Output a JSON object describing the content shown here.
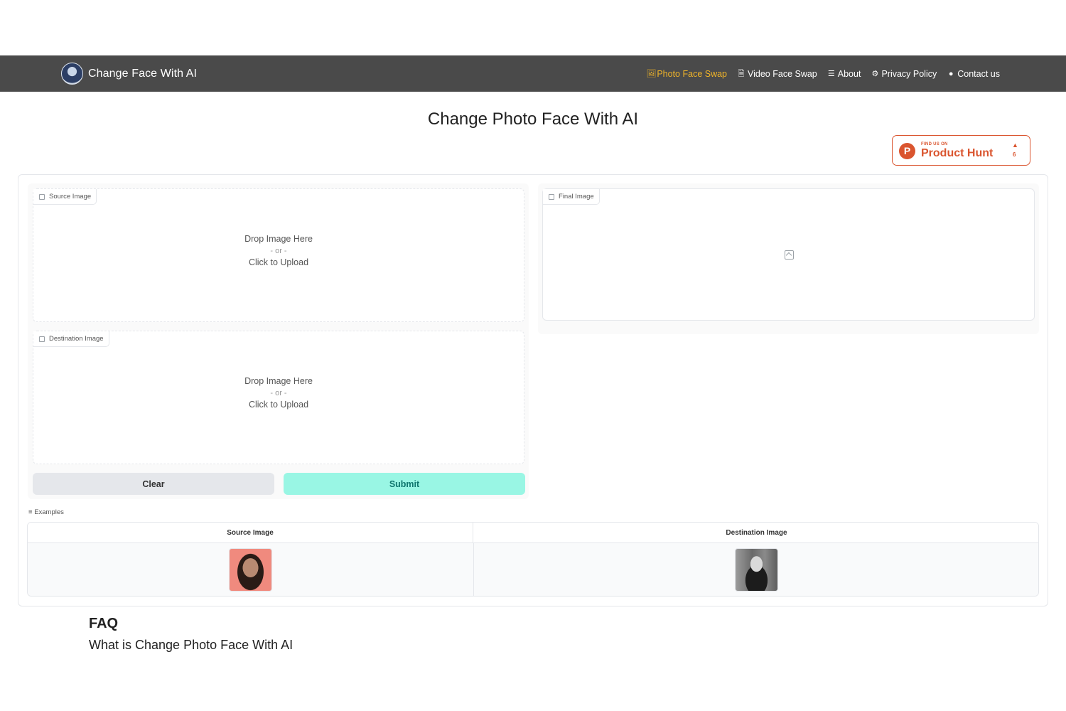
{
  "brand": {
    "title": "Change Face With AI",
    "icon": "avatar-logo"
  },
  "nav": {
    "items": [
      {
        "label": "Photo Face Swap",
        "icon": "image-file-icon",
        "active": true
      },
      {
        "label": "Video Face Swap",
        "icon": "video-file-icon",
        "active": false
      },
      {
        "label": "About",
        "icon": "list-icon",
        "active": false
      },
      {
        "label": "Privacy Policy",
        "icon": "lock-icon",
        "active": false
      },
      {
        "label": "Contact us",
        "icon": "chat-icon",
        "active": false
      }
    ],
    "active_color": "#f0b429"
  },
  "page": {
    "title": "Change Photo Face With AI"
  },
  "product_hunt": {
    "small_text": "FIND US ON",
    "name": "Product Hunt",
    "count": "6",
    "color": "#da552f"
  },
  "source": {
    "label": "Source Image",
    "drop": "Drop Image Here",
    "or": "- or -",
    "click": "Click to Upload"
  },
  "destination": {
    "label": "Destination Image",
    "drop": "Drop Image Here",
    "or": "- or -",
    "click": "Click to Upload"
  },
  "final": {
    "label": "Final Image"
  },
  "buttons": {
    "clear": "Clear",
    "submit": "Submit",
    "submit_color": "#99f6e4"
  },
  "examples": {
    "label": "Examples",
    "headers": [
      "Source Image",
      "Destination Image"
    ]
  },
  "faq": {
    "title": "FAQ",
    "question": "What is Change Photo Face With AI"
  }
}
